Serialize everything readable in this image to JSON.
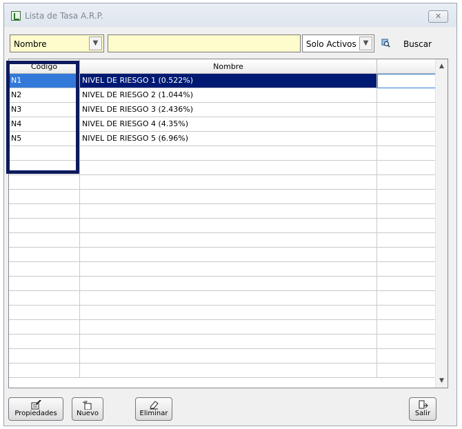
{
  "window": {
    "title": "Lista de Tasa A.R.P.",
    "close_icon": "close-icon"
  },
  "toolbar": {
    "field_combo": {
      "value": "Nombre"
    },
    "search_text": {
      "value": ""
    },
    "status_combo": {
      "value": "Solo Activos"
    },
    "search_button_label": "Buscar"
  },
  "grid": {
    "columns": [
      "Código",
      "Nombre",
      ""
    ],
    "rows": [
      {
        "codigo": "N1",
        "nombre": "NIVEL DE RIESGO 1 (0.522%)",
        "selected": true
      },
      {
        "codigo": "N2",
        "nombre": "NIVEL DE RIESGO 2 (1.044%)",
        "selected": false
      },
      {
        "codigo": "N3",
        "nombre": "NIVEL DE RIESGO 3 (2.436%)",
        "selected": false
      },
      {
        "codigo": "N4",
        "nombre": "NIVEL DE RIESGO 4 (4.35%)",
        "selected": false
      },
      {
        "codigo": "N5",
        "nombre": "NIVEL DE RIESGO 5 (6.96%)",
        "selected": false
      }
    ],
    "empty_rows": 16
  },
  "footer": {
    "properties_label": "Propiedades",
    "new_label": "Nuevo",
    "delete_label": "Eliminar",
    "exit_label": "Salir"
  },
  "colors": {
    "selection_code": "#3379d9",
    "selection_name": "#001a73",
    "input_background": "#fefccc",
    "highlight_box": "#0d1a5c"
  }
}
